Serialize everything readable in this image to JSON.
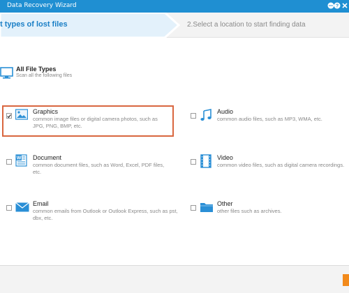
{
  "titlebar": {
    "title": "Data Recovery Wizard",
    "icons": [
      "chat-icon",
      "help-icon",
      "close-icon"
    ],
    "color": "#1f8fd2"
  },
  "steps": {
    "active_label": "t types of lost files",
    "next_label": "2.Select a location to start finding data"
  },
  "all_types": {
    "name": "All File Types",
    "description": "Scan all the following files",
    "icon": "monitor-icon"
  },
  "file_types": [
    {
      "id": "graphics",
      "name": "Graphics",
      "description": "common image files or digital camera photos, such as JPG, PNG, BMP, etc.",
      "checked": true,
      "icon": "image-icon"
    },
    {
      "id": "audio",
      "name": "Audio",
      "description": "common audio files, such as MP3, WMA, etc.",
      "checked": false,
      "icon": "music-note-icon"
    },
    {
      "id": "document",
      "name": "Document",
      "description": "common document files, such as Word, Excel, PDF files, etc.",
      "checked": false,
      "icon": "word-document-icon"
    },
    {
      "id": "video",
      "name": "Video",
      "description": "common video files, such as digital camera recordings.",
      "checked": false,
      "icon": "film-icon"
    },
    {
      "id": "email",
      "name": "Email",
      "description": "common emails from Outlook or Outlook Express, such as pst, dbx, etc.",
      "checked": false,
      "icon": "envelope-icon"
    },
    {
      "id": "other",
      "name": "Other",
      "description": "other files such as archives.",
      "checked": false,
      "icon": "folder-icon"
    }
  ],
  "colors": {
    "accent": "#1f8fd2",
    "highlight_border": "#d9663f",
    "scan_button": "#f28a1b"
  }
}
